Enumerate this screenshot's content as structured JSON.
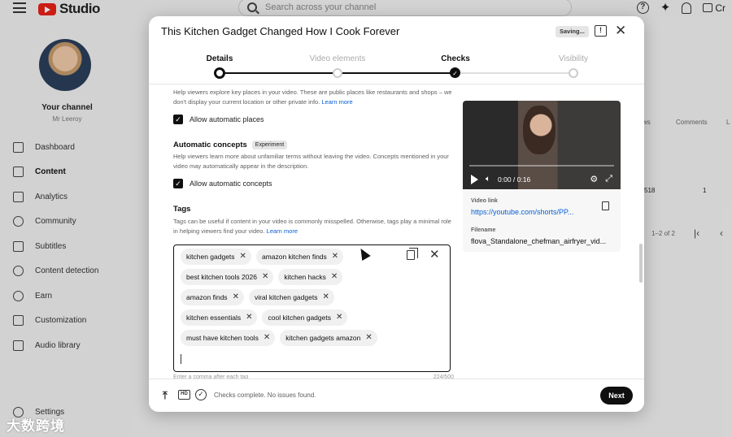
{
  "app": {
    "name": "Studio"
  },
  "search": {
    "placeholder": "Search across your channel"
  },
  "topbar": {
    "create_label": "Cr"
  },
  "sidebar": {
    "channel_title": "Your channel",
    "channel_name": "Mr Leeroy",
    "items": [
      {
        "label": "Dashboard",
        "icon": "dashboard-icon"
      },
      {
        "label": "Content",
        "icon": "content-icon",
        "active": true
      },
      {
        "label": "Analytics",
        "icon": "analytics-icon"
      },
      {
        "label": "Community",
        "icon": "community-icon"
      },
      {
        "label": "Subtitles",
        "icon": "subtitles-icon"
      },
      {
        "label": "Content detection",
        "icon": "copyright-icon"
      },
      {
        "label": "Earn",
        "icon": "dollar-icon"
      },
      {
        "label": "Customization",
        "icon": "magic-wand-icon"
      },
      {
        "label": "Audio library",
        "icon": "audio-library-icon"
      }
    ],
    "settings_label": "Settings"
  },
  "background_table": {
    "col_views": "ws",
    "col_comments": "Comments",
    "col_likes": "L",
    "row_views": "518",
    "row_comments": "1",
    "pagination": "1–2 of 2",
    "partial_text": "ns"
  },
  "dialog": {
    "title": "This Kitchen Gadget Changed How I Cook Forever",
    "saving_label": "Saving...",
    "steps": [
      {
        "label": "Details",
        "state": "active"
      },
      {
        "label": "Video elements",
        "state": "pending"
      },
      {
        "label": "Checks",
        "state": "done"
      },
      {
        "label": "Visibility",
        "state": "pending"
      }
    ],
    "places": {
      "help": "Help viewers explore key places in your video. These are public places like restaurants and shops – we don't display your current location or other private info.",
      "learn_more": "Learn more",
      "checkbox_label": "Allow automatic places"
    },
    "concepts": {
      "title": "Automatic concepts",
      "badge": "Experiment",
      "help": "Help viewers learn more about unfamiliar terms without leaving the video. Concepts mentioned in your video may automatically appear in the description.",
      "checkbox_label": "Allow automatic concepts"
    },
    "tags": {
      "title": "Tags",
      "help": "Tags can be useful if content in your video is commonly misspelled. Otherwise, tags play a minimal role in helping viewers find your video.",
      "learn_more": "Learn more",
      "items": [
        "kitchen gadgets",
        "amazon kitchen finds",
        "best kitchen tools 2026",
        "kitchen hacks",
        "amazon finds",
        "viral kitchen gadgets",
        "kitchen essentials",
        "cool kitchen gadgets",
        "must have kitchen tools",
        "kitchen gadgets amazon"
      ],
      "below_left": "Enter a comma after each tag",
      "below_right": "224/500"
    },
    "preview": {
      "time": "0:00 / 0:16",
      "video_link_label": "Video link",
      "video_link": "https://youtube.com/shorts/PP...",
      "filename_label": "Filename",
      "filename": "flova_Standalone_chefman_airfryer_vid..."
    },
    "footer": {
      "status": "Checks complete. No issues found.",
      "next_label": "Next"
    }
  },
  "watermark": "大数跨境"
}
